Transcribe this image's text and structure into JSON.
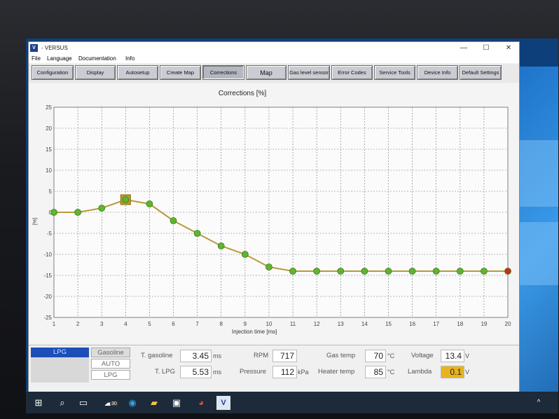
{
  "window": {
    "title": "- VERSUS",
    "icon_label": "V",
    "minimize": "—",
    "maximize": "☐",
    "close": "✕"
  },
  "menu": [
    "File",
    "Language",
    "Documentation",
    "Info"
  ],
  "toolbar": [
    {
      "label": "Configuration"
    },
    {
      "label": "Display"
    },
    {
      "label": "Autosetup"
    },
    {
      "label": "Create Map"
    },
    {
      "label": "Corrections",
      "active": true
    },
    {
      "label": "Map"
    },
    {
      "label": "Gas level sensor"
    },
    {
      "label": "Error Codes"
    },
    {
      "label": "Service Tools"
    },
    {
      "label": "Device Info"
    },
    {
      "label": "Default Settings"
    }
  ],
  "chart_data": {
    "type": "line",
    "title": "Corrections [%]",
    "xlabel": "Injection time [ms]",
    "ylabel": "[%]",
    "x": [
      1,
      2,
      3,
      4,
      5,
      6,
      7,
      8,
      9,
      10,
      11,
      12,
      13,
      14,
      15,
      16,
      17,
      18,
      19,
      20
    ],
    "values": [
      0,
      0,
      1,
      3,
      2,
      -2,
      -5,
      -8,
      -10,
      -13,
      -14,
      -14,
      -14,
      -14,
      -14,
      -14,
      -14,
      -14,
      -14,
      -14
    ],
    "selected_index": 3,
    "last_point_color": "#cc2a1a",
    "point_color": "#5fb52f",
    "line_color": "#b89a3a",
    "xlim": [
      1,
      20
    ],
    "ylim": [
      -25,
      25
    ],
    "yticks": [
      25,
      20,
      15,
      10,
      5,
      0,
      -5,
      -10,
      -15,
      -20,
      -25
    ],
    "xticks": [
      1,
      2,
      3,
      4,
      5,
      6,
      7,
      8,
      9,
      10,
      11,
      12,
      13,
      14,
      15,
      16,
      17,
      18,
      19,
      20
    ],
    "grid": true
  },
  "status": {
    "fuel_mode": {
      "current": "LPG",
      "options": [
        "Gasoline",
        "AUTO",
        "LPG"
      ]
    },
    "t_gasoline": {
      "label": "T. gasoline",
      "value": "3.45",
      "unit": "ms"
    },
    "t_lpg": {
      "label": "T. LPG",
      "value": "5.53",
      "unit": "ms"
    },
    "rpm": {
      "label": "RPM",
      "value": "717",
      "unit": ""
    },
    "pressure": {
      "label": "Pressure",
      "value": "112",
      "unit": "kPa"
    },
    "gas_temp": {
      "label": "Gas temp",
      "value": "70",
      "unit": "°C"
    },
    "heater_temp": {
      "label": "Heater temp",
      "value": "85",
      "unit": "°C"
    },
    "voltage": {
      "label": "Voltage",
      "value": "13.4",
      "unit": "V"
    },
    "lambda": {
      "label": "Lambda",
      "value": "0.1",
      "unit": "V",
      "highlight": "#e8b320"
    }
  },
  "taskbar": {
    "icons": [
      "start-icon",
      "search-icon",
      "task-view-icon",
      "weather-icon",
      "edge-icon",
      "file-explorer-icon",
      "store-icon",
      "chrome-icon",
      "versus-icon"
    ],
    "weather_badge": "30",
    "chevron": "^"
  }
}
